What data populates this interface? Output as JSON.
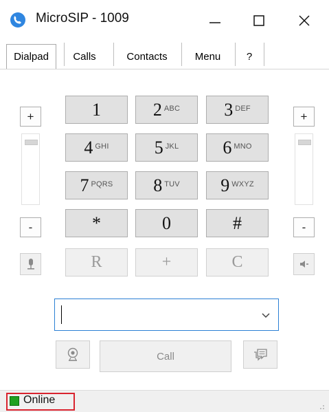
{
  "window": {
    "title": "MicroSIP - 1009",
    "icon": "microsip-logo-icon"
  },
  "caption_buttons": {
    "minimize": "minimize-icon",
    "maximize": "maximize-icon",
    "close": "close-icon"
  },
  "tabs": [
    {
      "label": "Dialpad",
      "active": true
    },
    {
      "label": "Calls"
    },
    {
      "label": "Contacts"
    },
    {
      "label": "Menu"
    },
    {
      "label": "?"
    }
  ],
  "volume": {
    "plus_label": "+",
    "minus_label": "-",
    "mic_icon": "microphone-icon",
    "speaker_icon": "speaker-icon"
  },
  "dialpad": {
    "keys": [
      {
        "digit": "1",
        "letters": ""
      },
      {
        "digit": "2",
        "letters": "ABC"
      },
      {
        "digit": "3",
        "letters": "DEF"
      },
      {
        "digit": "4",
        "letters": "GHI"
      },
      {
        "digit": "5",
        "letters": "JKL"
      },
      {
        "digit": "6",
        "letters": "MNO"
      },
      {
        "digit": "7",
        "letters": "PQRS"
      },
      {
        "digit": "8",
        "letters": "TUV"
      },
      {
        "digit": "9",
        "letters": "WXYZ"
      },
      {
        "digit": "*",
        "letters": ""
      },
      {
        "digit": "0",
        "letters": ""
      },
      {
        "digit": "#",
        "letters": ""
      },
      {
        "digit": "R",
        "letters": ""
      },
      {
        "digit": "+",
        "letters": ""
      },
      {
        "digit": "C",
        "letters": ""
      }
    ]
  },
  "number_input": {
    "value": "",
    "dropdown_icon": "chevron-down-icon"
  },
  "actions": {
    "call_label": "Call",
    "video_icon": "webcam-icon",
    "message_icon": "message-icon"
  },
  "status": {
    "text": "Online",
    "color": "#20a020"
  },
  "colors": {
    "accent": "#2a7fd4",
    "status_frame": "#d9232e"
  }
}
